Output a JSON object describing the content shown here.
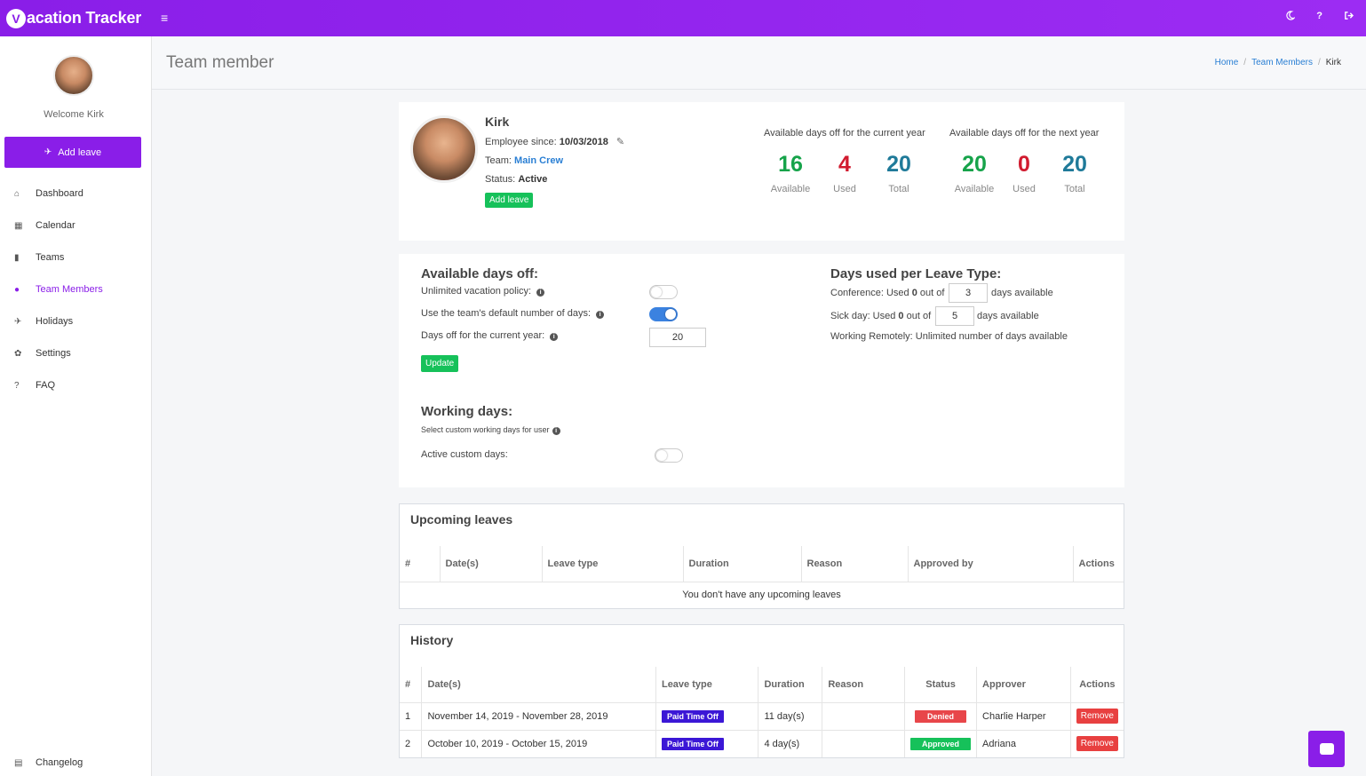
{
  "app": {
    "logo_letter": "V",
    "title": "acation Tracker"
  },
  "topbar": {
    "menu_icon": "≡",
    "icons": [
      "moon-icon",
      "help-icon",
      "logout-icon"
    ]
  },
  "sidebar": {
    "welcome": "Welcome Kirk",
    "add_leave": "Add leave",
    "items": [
      {
        "label": "Dashboard",
        "icon": "home-icon"
      },
      {
        "label": "Calendar",
        "icon": "calendar-icon"
      },
      {
        "label": "Teams",
        "icon": "building-icon"
      },
      {
        "label": "Team Members",
        "icon": "users-icon",
        "active": true
      },
      {
        "label": "Holidays",
        "icon": "plane-icon"
      },
      {
        "label": "Settings",
        "icon": "gear-icon"
      },
      {
        "label": "FAQ",
        "icon": "question-icon"
      }
    ],
    "changelog": "Changelog"
  },
  "header": {
    "title": "Team member",
    "breadcrumb": {
      "home": "Home",
      "members": "Team Members",
      "current": "Kirk"
    }
  },
  "employee": {
    "name": "Kirk",
    "since_label": "Employee since:",
    "since": "10/03/2018",
    "team_label": "Team:",
    "team": "Main Crew",
    "status_label": "Status:",
    "status": "Active",
    "add_leave": "Add leave"
  },
  "stats": {
    "current_year_label": "Available days off for the current year",
    "next_year_label": "Available days off for the next year",
    "current": {
      "available": "16",
      "used": "4",
      "total": "20"
    },
    "next": {
      "available": "20",
      "used": "0",
      "total": "20"
    },
    "labels": {
      "available": "Available",
      "used": "Used",
      "total": "Total"
    },
    "colors": {
      "available": "#16a34a",
      "used": "#d11b2f",
      "total": "#1f7a99"
    }
  },
  "days_off": {
    "title": "Available days off:",
    "unlimited_label": "Unlimited vacation policy:",
    "unlimited_on": false,
    "default_label": "Use the team's default number of days:",
    "default_on": true,
    "current_year_label": "Days off for the current year:",
    "current_year_value": "20",
    "update": "Update"
  },
  "leave_types": {
    "title": "Days used per Leave Type:",
    "conference": {
      "prefix": "Conference: Used ",
      "used": "0",
      "mid": " out of",
      "value": "3",
      "suffix": "days available"
    },
    "sick": {
      "prefix": "Sick day: Used ",
      "used": "0",
      "mid": " out of",
      "value": "5",
      "suffix": "days available"
    },
    "remote": "Working Remotely: Unlimited number of days available"
  },
  "working_days": {
    "title": "Working days:",
    "subtitle": "Select custom working days for user",
    "active_label": "Active custom days:",
    "active_on": false
  },
  "upcoming": {
    "title": "Upcoming leaves",
    "columns": [
      "#",
      "Date(s)",
      "Leave type",
      "Duration",
      "Reason",
      "Approved by",
      "Actions"
    ],
    "empty": "You don't have any upcoming leaves"
  },
  "history": {
    "title": "History",
    "columns": [
      "#",
      "Date(s)",
      "Leave type",
      "Duration",
      "Reason",
      "Status",
      "Approver",
      "Actions"
    ],
    "rows": [
      {
        "n": "1",
        "dates": "November 14, 2019 - November 28, 2019",
        "type": "Paid Time Off",
        "duration": "11 day(s)",
        "reason": "",
        "status": "Denied",
        "approver": "Charlie Harper",
        "action": "Remove"
      },
      {
        "n": "2",
        "dates": "October 10, 2019 - October 15, 2019",
        "type": "Paid Time Off",
        "duration": "4 day(s)",
        "reason": "",
        "status": "Approved",
        "approver": "Adriana",
        "action": "Remove"
      }
    ]
  }
}
